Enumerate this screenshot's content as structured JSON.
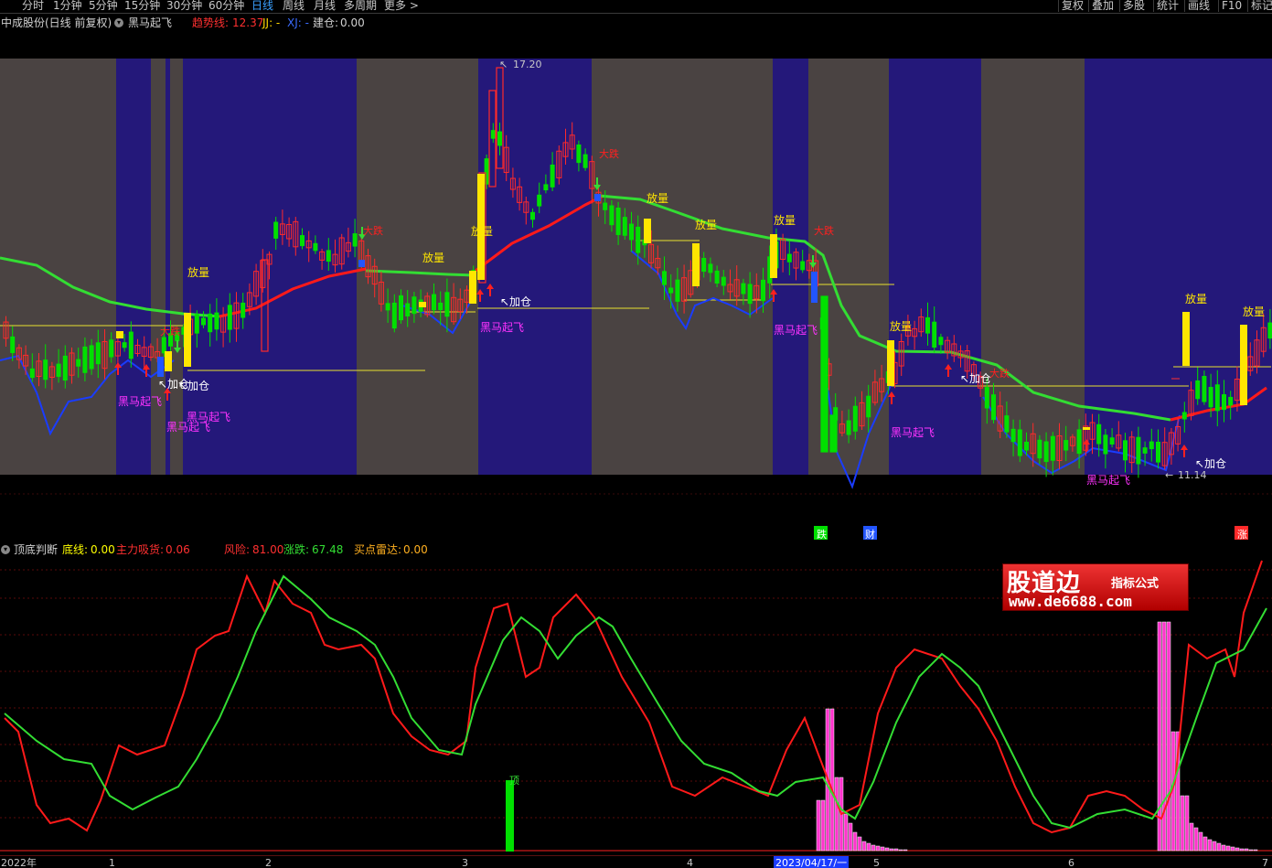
{
  "toolbar": {
    "periods": [
      "分时",
      "1分钟",
      "5分钟",
      "15分钟",
      "30分钟",
      "60分钟",
      "日线",
      "周线",
      "月线",
      "多周期",
      "更多 >"
    ],
    "active_period": "日线",
    "right_tools": [
      "复权",
      "叠加",
      "多股",
      "统计",
      "画线",
      "F10",
      "标记"
    ]
  },
  "main_panel": {
    "title": "中成股份(日线 前复权)",
    "indicator": "黑马起飞",
    "trend_label": "趋势线:",
    "trend_value": "12.37",
    "jj_label": "JJ: -",
    "xj_label": "XJ: -",
    "jc_label": "建仓:",
    "jc_value": "0.00",
    "high_label": "17.20",
    "low_label": "11.14",
    "signals": {
      "fangliang": "放量",
      "jiacang": "加仓",
      "heima": "黑马起飞",
      "dadie": "大跌"
    },
    "event_markers": [
      "跌",
      "财",
      "涨"
    ]
  },
  "sub_panel": {
    "title": "顶底判断",
    "dixian_label": "底线:",
    "dixian_value": "0.00",
    "zhuli_label": "主力吸货:",
    "zhuli_value": "0.06",
    "risk_label": "风险:",
    "risk_value": "81.00",
    "zhangdie_label": "涨跌:",
    "zhangdie_value": "67.48",
    "radar_label": "买点雷达:",
    "radar_value": "0.00",
    "top_marker": "顶"
  },
  "watermark": {
    "big": "股道边",
    "small": "指标公式",
    "url": "www.de6688.com"
  },
  "date_axis": [
    "2022年",
    "1",
    "2",
    "3",
    "4",
    "2023/04/17/一",
    "5",
    "6",
    "7"
  ],
  "colors": {
    "background": "#000000",
    "up_candle": "#ff2a2a",
    "down_candle": "#00e000",
    "trend_up": "#ff1a1a",
    "trend_down": "#33dd33",
    "support_line": "#1a3cff",
    "zone_dark": "#24187a",
    "zone_grey": "#4a4342",
    "volume_signal": "#ffe600",
    "magenta": "#ff33ff"
  }
}
